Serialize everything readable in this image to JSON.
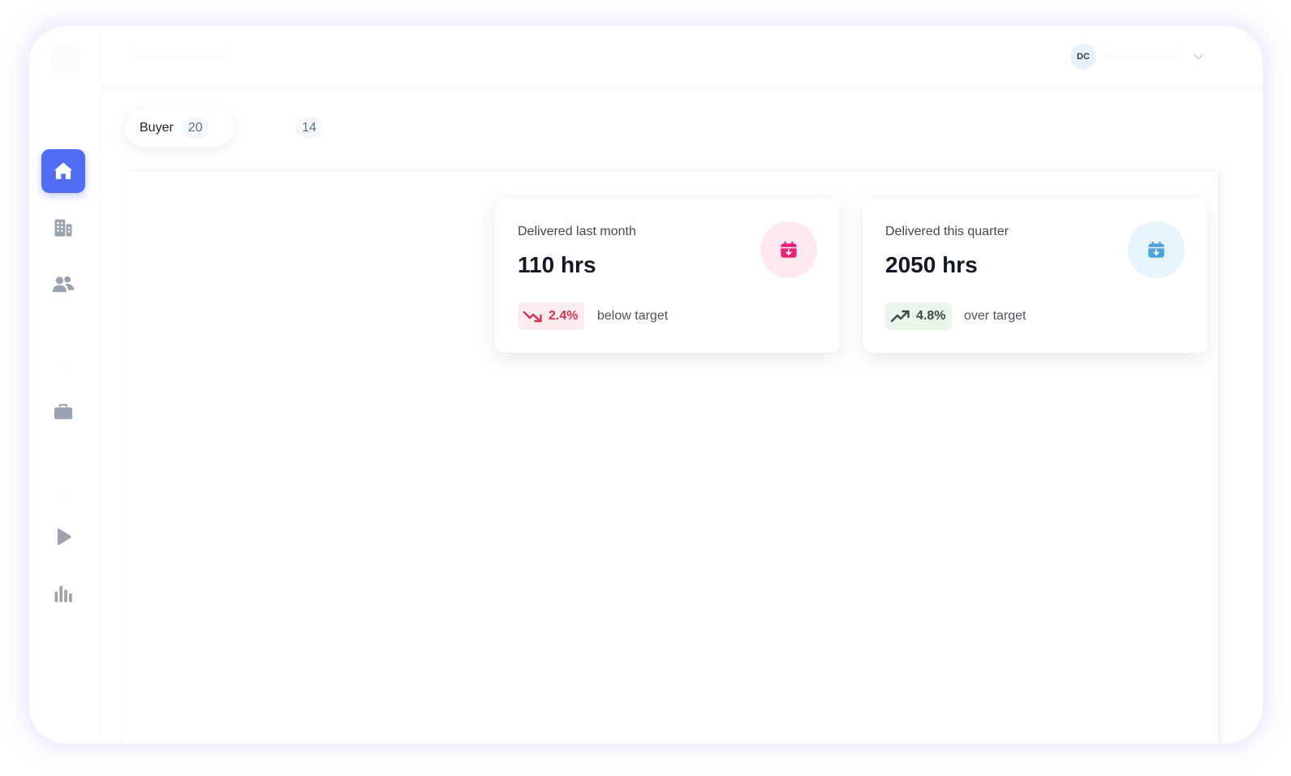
{
  "header": {
    "user_initials": "DC"
  },
  "sidebar": {
    "items": [
      {
        "icon": "home-icon",
        "active": true
      },
      {
        "icon": "building-icon",
        "active": false
      },
      {
        "icon": "users-icon",
        "active": false
      },
      {
        "icon": "briefcase-icon",
        "active": false
      },
      {
        "icon": "play-icon",
        "active": false
      },
      {
        "icon": "bar-chart-icon",
        "active": false
      }
    ]
  },
  "tabs": [
    {
      "label": "Buyer",
      "count": "20",
      "active": true
    },
    {
      "label": "",
      "count": "14",
      "active": false
    }
  ],
  "cards": [
    {
      "label": "Delivered last month",
      "value": "110 hrs",
      "delta": "2.4%",
      "delta_direction": "down",
      "delta_text": "below target",
      "icon": "calendar-download-icon",
      "icon_color": "#e8217a",
      "icon_bg": "#fde8f0",
      "delta_color": "#d9334f",
      "delta_bg": "#fdecee"
    },
    {
      "label": "Delivered this quarter",
      "value": "2050 hrs",
      "delta": "4.8%",
      "delta_direction": "up",
      "delta_text": "over target",
      "icon": "calendar-download-icon",
      "icon_color": "#4aa3df",
      "icon_bg": "#e6f4fd",
      "delta_color": "#3f4a44",
      "delta_bg": "#e9f7ea"
    }
  ],
  "colors": {
    "accent": "#4f6df5",
    "nav_icon": "#9aa3af"
  }
}
